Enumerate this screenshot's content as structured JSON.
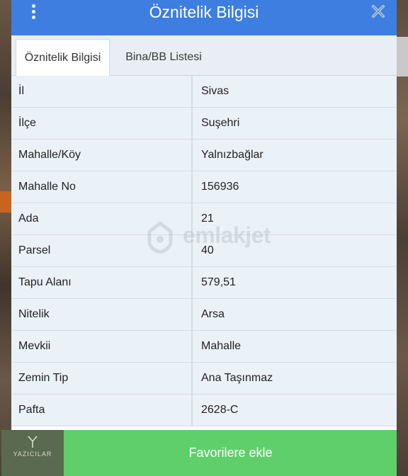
{
  "header": {
    "title": "Öznitelik Bilgisi"
  },
  "tabs": [
    {
      "label": "Öznitelik Bilgisi",
      "active": true
    },
    {
      "label": "Bina/BB Listesi",
      "active": false
    }
  ],
  "attributes": [
    {
      "key": "İl",
      "value": "Sivas"
    },
    {
      "key": "İlçe",
      "value": "Suşehri"
    },
    {
      "key": "Mahalle/Köy",
      "value": "Yalnızbağlar"
    },
    {
      "key": "Mahalle No",
      "value": "156936"
    },
    {
      "key": "Ada",
      "value": "21"
    },
    {
      "key": "Parsel",
      "value": "40"
    },
    {
      "key": "Tapu Alanı",
      "value": "579,51"
    },
    {
      "key": "Nitelik",
      "value": "Arsa"
    },
    {
      "key": "Mevkii",
      "value": "Mahalle"
    },
    {
      "key": "Zemin Tip",
      "value": "Ana Taşınmaz"
    },
    {
      "key": "Pafta",
      "value": "2628-C"
    }
  ],
  "watermark": {
    "text": "emlakjet"
  },
  "footer": {
    "favorite_label": "Favorilere ekle",
    "logo_text": "YAZICILAR"
  },
  "colors": {
    "header": "#3d7ee0",
    "favorite_button": "#5fcf6a",
    "row_background": "#eaf1f7"
  }
}
